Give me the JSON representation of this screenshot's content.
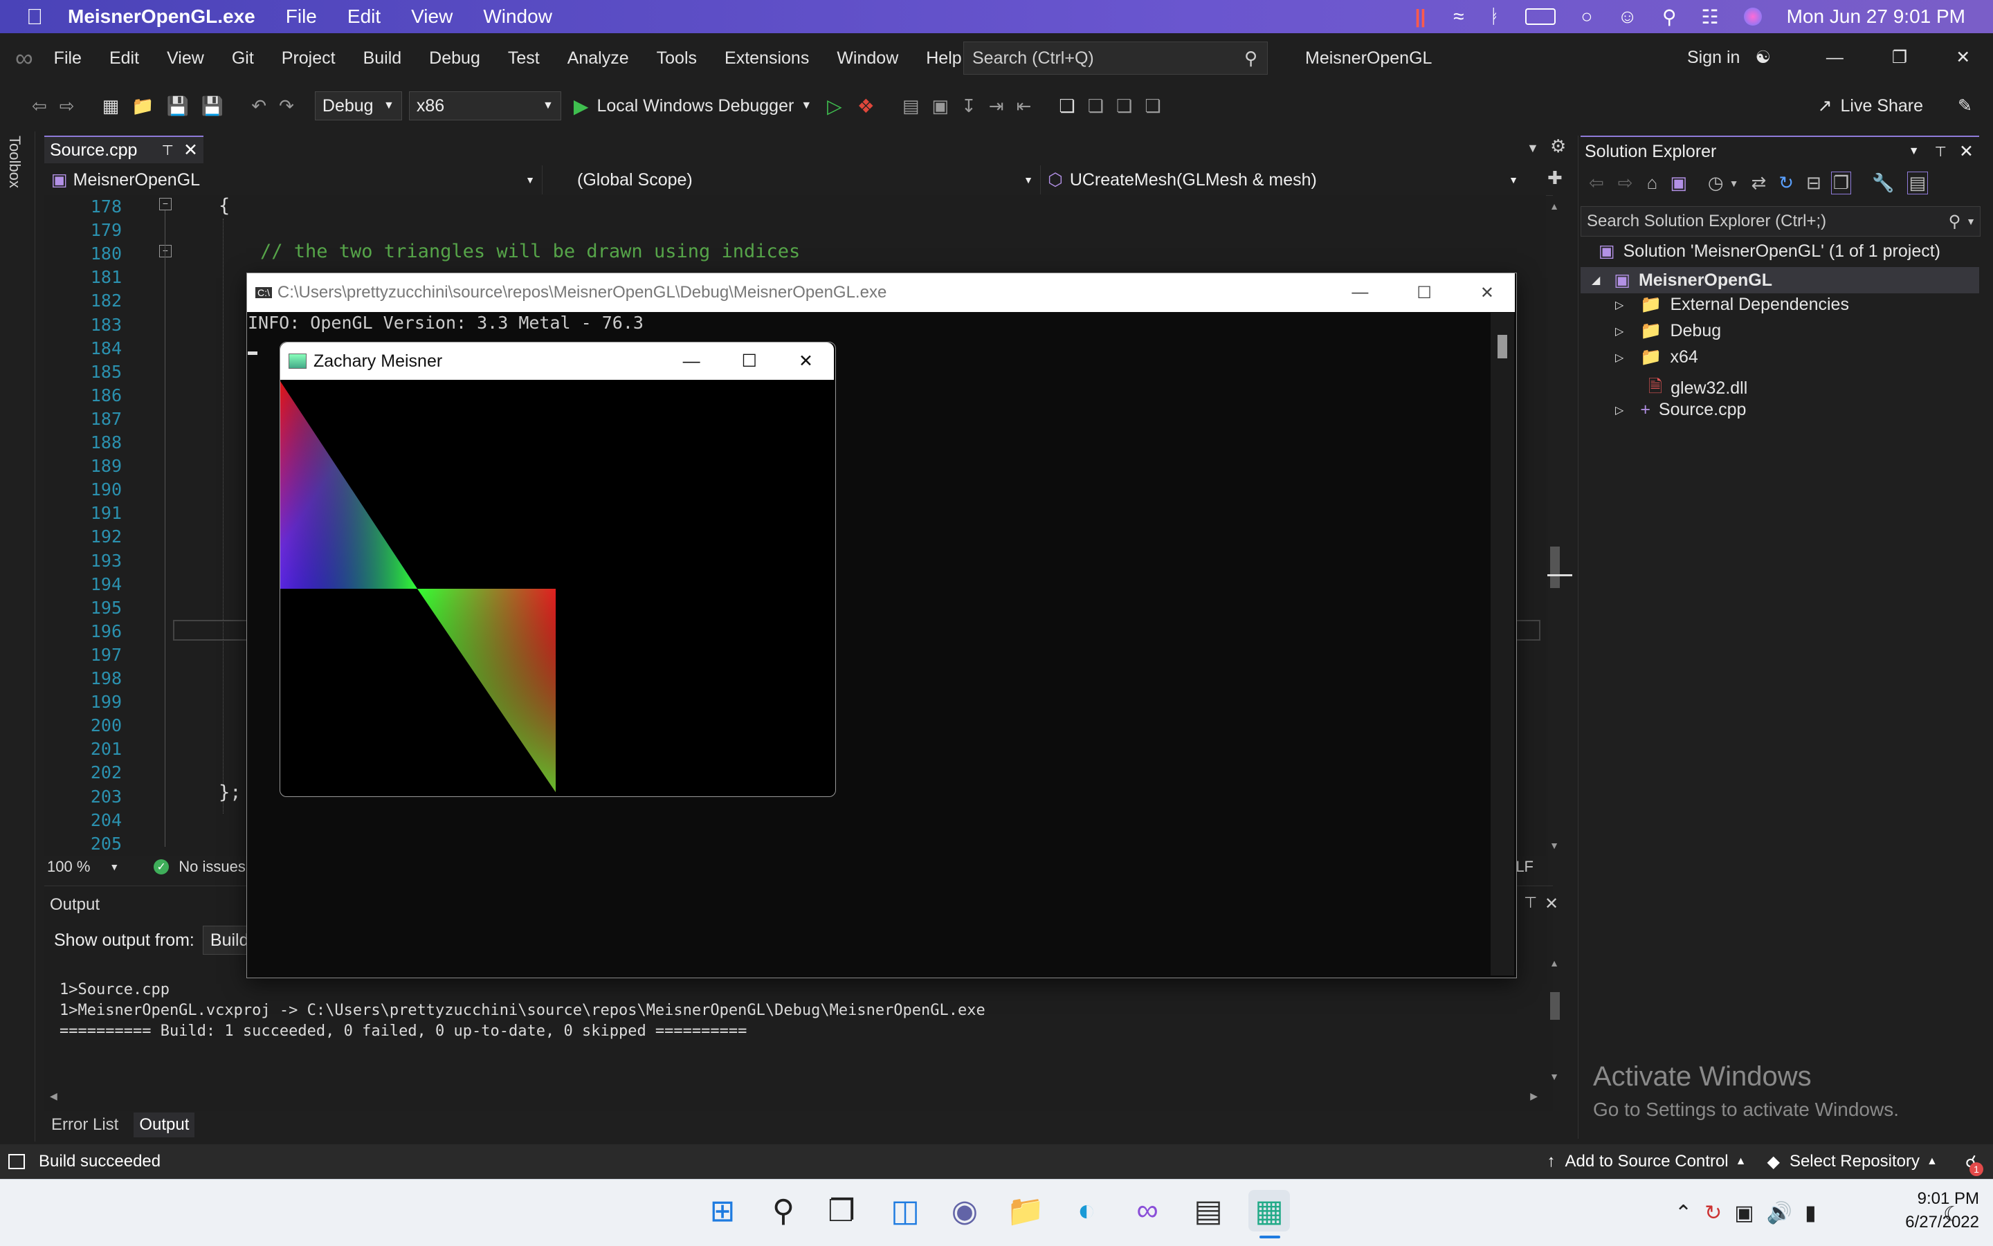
{
  "mac_menubar": {
    "app_name": "MeisnerOpenGL.exe",
    "menus": [
      "File",
      "Edit",
      "View",
      "Window"
    ],
    "datetime": "Mon Jun 27  9:01 PM"
  },
  "vs": {
    "menus": [
      "File",
      "Edit",
      "View",
      "Git",
      "Project",
      "Build",
      "Debug",
      "Test",
      "Analyze",
      "Tools",
      "Extensions",
      "Window",
      "Help"
    ],
    "search_placeholder": "Search (Ctrl+Q)",
    "solution_name": "MeisnerOpenGL",
    "sign_in": "Sign in",
    "live_share": "Live Share",
    "toolbar": {
      "config": "Debug",
      "platform": "x86",
      "debugger": "Local Windows Debugger"
    },
    "toolbox_label": "Toolbox",
    "editor": {
      "tab": "Source.cpp",
      "nav_project": "MeisnerOpenGL",
      "nav_scope": "(Global Scope)",
      "nav_member": "UCreateMesh(GLMesh & mesh)",
      "line_numbers": [
        "178",
        "179",
        "180",
        "181",
        "182",
        "183",
        "184",
        "185",
        "186",
        "187",
        "188",
        "189",
        "190",
        "191",
        "192",
        "193",
        "194",
        "195",
        "196",
        "197",
        "198",
        "199",
        "200",
        "201",
        "202",
        "203",
        "204",
        "205"
      ],
      "open_brace": "{",
      "comment": "// the two triangles will be drawn using indices",
      "close_brace": "};",
      "zoom": "100 %",
      "issues": "No issues",
      "line_ending": "CRLF"
    },
    "output": {
      "title": "Output",
      "show_from_label": "Show output from:",
      "show_from_value": "Build",
      "lines": [
        "1>Source.cpp",
        "1>MeisnerOpenGL.vcxproj -> C:\\Users\\prettyzucchini\\source\\repos\\MeisnerOpenGL\\Debug\\MeisnerOpenGL.exe",
        "========== Build: 1 succeeded, 0 failed, 0 up-to-date, 0 skipped =========="
      ]
    },
    "bottom_tabs": [
      "Error List",
      "Output"
    ],
    "solution_explorer": {
      "title": "Solution Explorer",
      "search_placeholder": "Search Solution Explorer (Ctrl+;)",
      "solution": "Solution 'MeisnerOpenGL' (1 of 1 project)",
      "project": "MeisnerOpenGL",
      "items": [
        "External Dependencies",
        "Debug",
        "x64",
        "glew32.dll",
        "Source.cpp"
      ]
    },
    "activate_title": "Activate Windows",
    "activate_sub": "Go to Settings to activate Windows.",
    "status": {
      "left": "Build succeeded",
      "source_control": "Add to Source Control",
      "repo": "Select Repository",
      "notifications": "1"
    }
  },
  "console": {
    "title": "C:\\Users\\prettyzucchini\\source\\repos\\MeisnerOpenGL\\Debug\\MeisnerOpenGL.exe",
    "line": "INFO: OpenGL Version: 3.3 Metal - 76.3"
  },
  "gl_window": {
    "title": "Zachary Meisner"
  },
  "taskbar": {
    "time": "9:01 PM",
    "date": "6/27/2022"
  }
}
